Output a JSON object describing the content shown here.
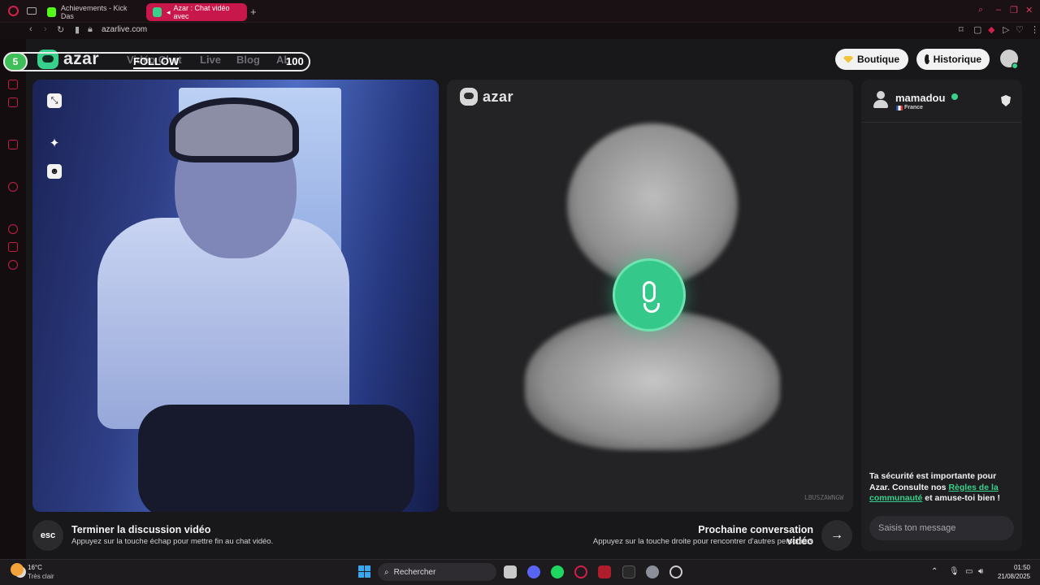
{
  "browser": {
    "tabs": [
      {
        "label": "Achievements - Kick Das"
      },
      {
        "label": "Azar : Chat vidéo avec"
      }
    ],
    "url": "azarlive.com"
  },
  "site": {
    "logo": "azar",
    "nav": [
      "Vidéo Chat",
      "Live",
      "Blog",
      "Ab"
    ],
    "buttons": {
      "boutique": "Boutique",
      "historique": "Historique"
    }
  },
  "stream_overlay": {
    "count": "5",
    "label": "FOLLOW",
    "target": "100"
  },
  "partner_video": {
    "logo": "azar",
    "watermark": "LBUSZAWNGW",
    "mic_state": "active",
    "accent_color": "#34c98a"
  },
  "chat": {
    "username": "mamadou",
    "country": "France",
    "safety_prefix": "Ta sécurité est importante pour Azar. Consulte nos ",
    "safety_link": "Règles de la communauté",
    "safety_suffix": " et amuse-toi bien !",
    "input_placeholder": "Saisis ton message"
  },
  "actions": {
    "esc_key": "esc",
    "end_title": "Terminer la discussion vidéo",
    "end_subtitle": "Appuyez sur la touche échap pour mettre fin au chat vidéo.",
    "next_title": "Prochaine conversation vidéo",
    "next_subtitle": "Appuyez sur la touche droite pour rencontrer d'autres personnes",
    "next_icon": "arrow-right-icon"
  },
  "taskbar": {
    "weather_temp": "16°C",
    "weather_cond": "Très clair",
    "search": "Rechercher",
    "time": "01:50",
    "date": "21/08/2025"
  }
}
